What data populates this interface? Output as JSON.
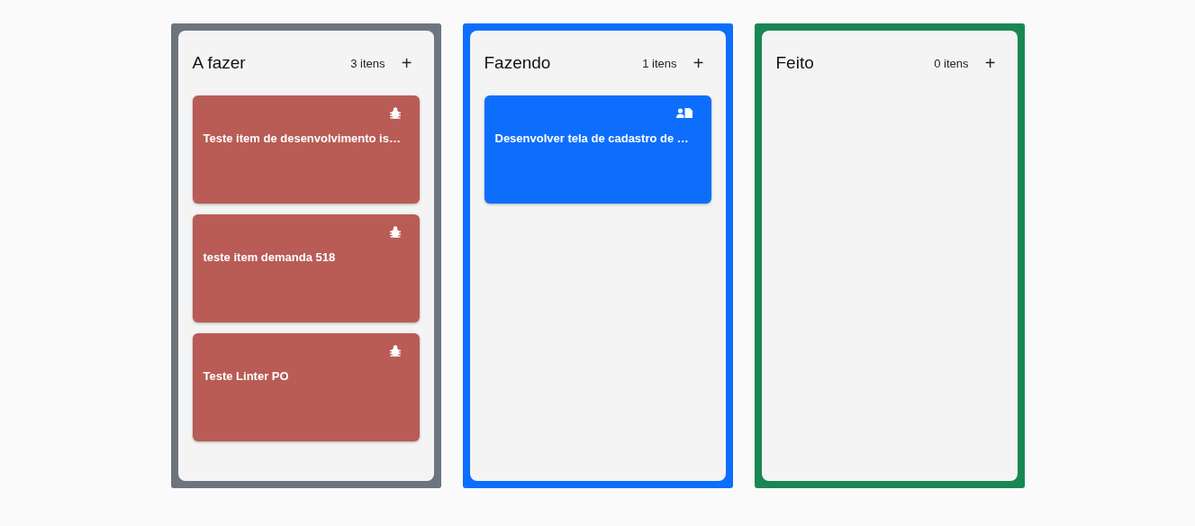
{
  "columns": [
    {
      "title": "A fazer",
      "count": "3 itens",
      "add": "+",
      "color": "#6c757d",
      "cards": [
        {
          "kind": "bug",
          "title": "Teste item de desenvolvimento is…"
        },
        {
          "kind": "bug",
          "title": "teste item demanda 518"
        },
        {
          "kind": "bug",
          "title": "Teste Linter PO"
        }
      ]
    },
    {
      "title": "Fazendo",
      "count": "1 itens",
      "add": "+",
      "color": "#0d6efd",
      "cards": [
        {
          "kind": "story",
          "title": "Desenvolver tela de cadastro de …"
        }
      ]
    },
    {
      "title": "Feito",
      "count": "0 itens",
      "add": "+",
      "color": "#198754"
    }
  ]
}
